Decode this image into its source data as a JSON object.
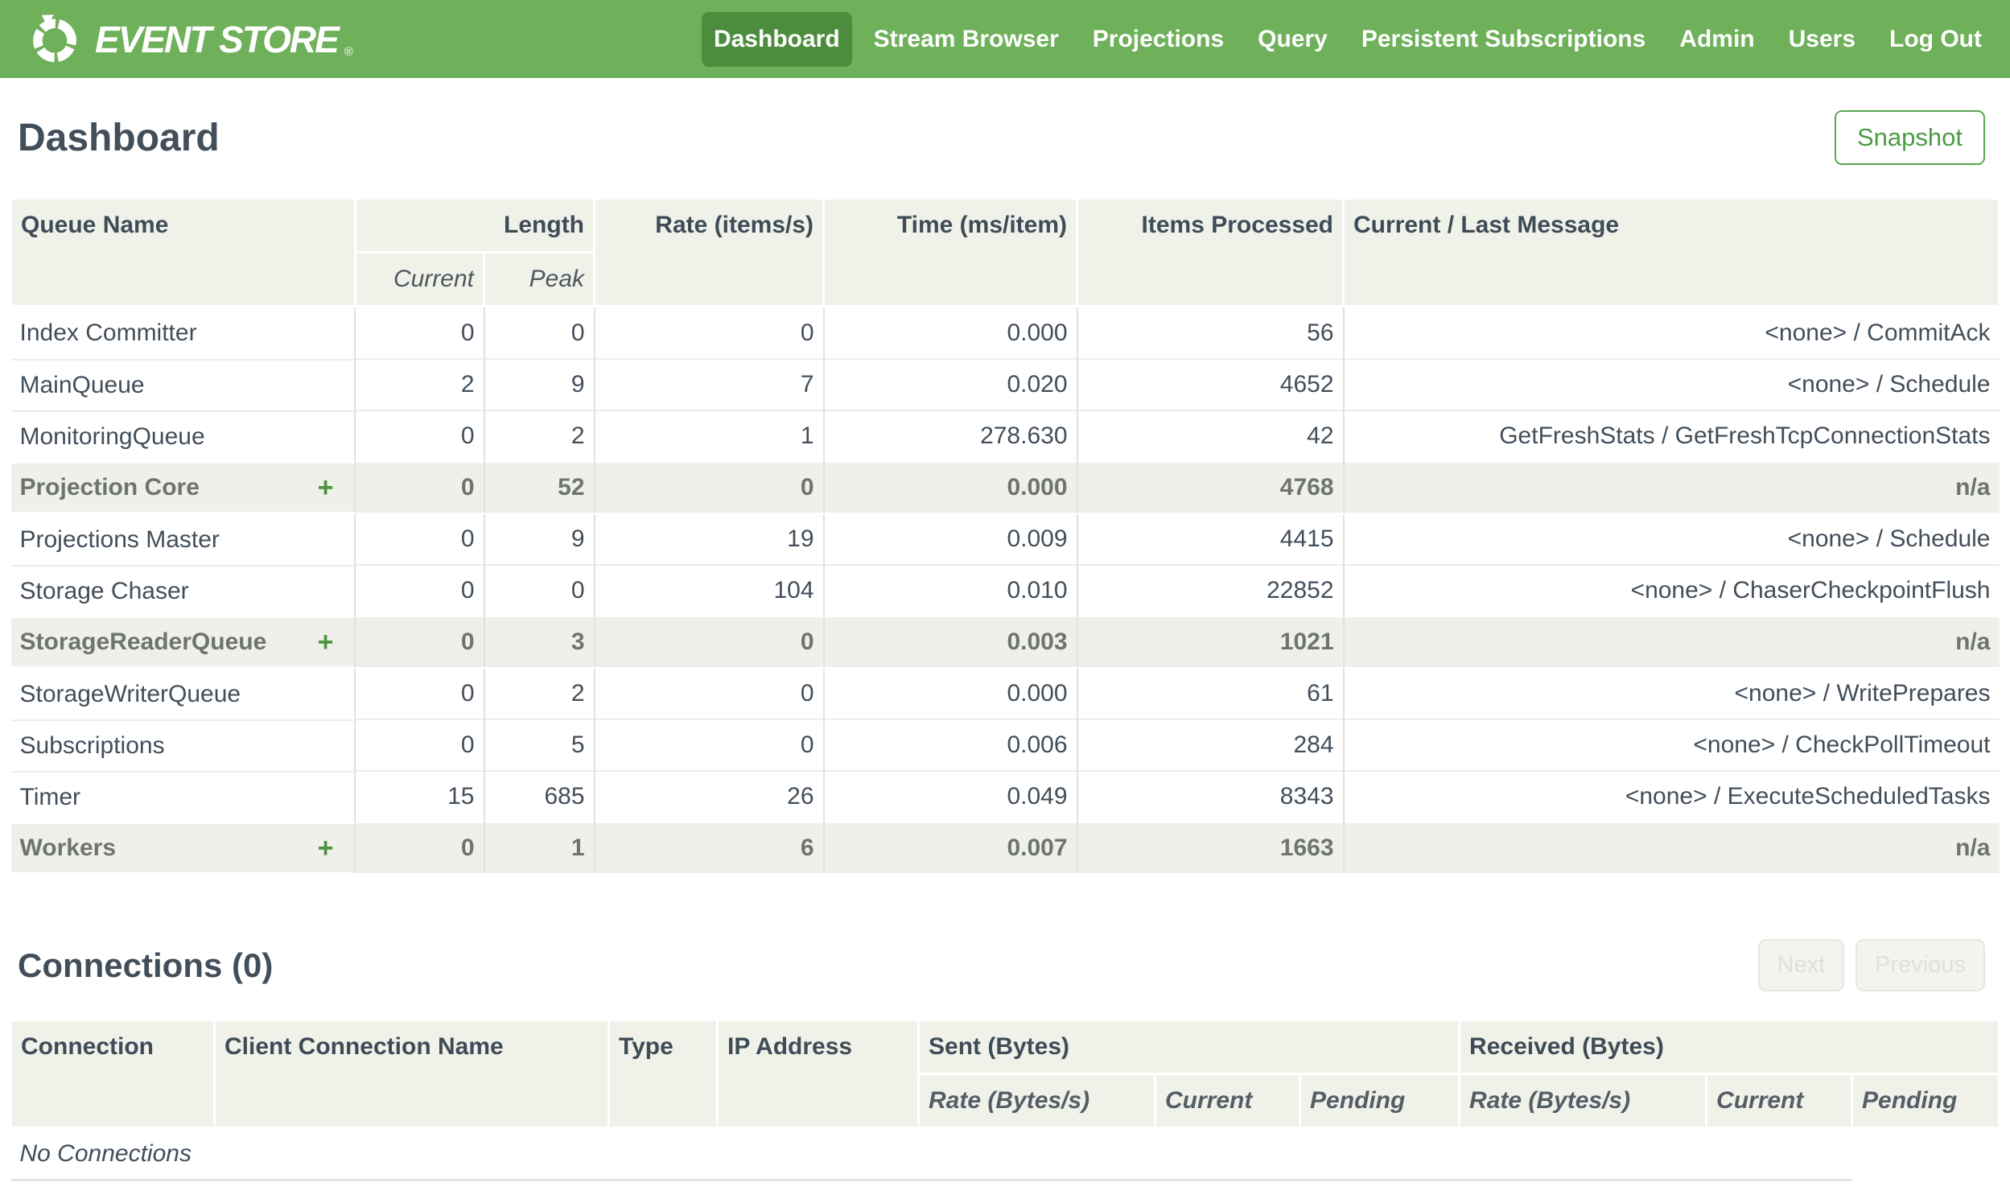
{
  "colors": {
    "brand_green": "#6FB05A",
    "active_nav_green": "#4C8D3D",
    "accent_green": "#4C9B43",
    "header_bg": "#F0F2EA",
    "summary_row_bg": "#EEF0E9",
    "text_dark": "#424E5A"
  },
  "nav": {
    "brand": "EVENT STORE",
    "brand_reg": "®",
    "items": [
      {
        "label": "Dashboard",
        "active": true
      },
      {
        "label": "Stream Browser",
        "active": false
      },
      {
        "label": "Projections",
        "active": false
      },
      {
        "label": "Query",
        "active": false
      },
      {
        "label": "Persistent Subscriptions",
        "active": false
      },
      {
        "label": "Admin",
        "active": false
      },
      {
        "label": "Users",
        "active": false
      },
      {
        "label": "Log Out",
        "active": false
      }
    ]
  },
  "page": {
    "title": "Dashboard",
    "snapshot_button": "Snapshot"
  },
  "queue_table": {
    "expand_icon": "+",
    "headers": {
      "queue_name": "Queue Name",
      "length": "Length",
      "current": "Current",
      "peak": "Peak",
      "rate": "Rate (items/s)",
      "time": "Time (ms/item)",
      "items_processed": "Items Processed",
      "message": "Current / Last Message"
    },
    "rows": [
      {
        "name": "Index Committer",
        "current": "0",
        "peak": "0",
        "rate": "0",
        "time": "0.000",
        "items": "56",
        "message": "<none> / CommitAck",
        "summary": false,
        "expandable": false
      },
      {
        "name": "MainQueue",
        "current": "2",
        "peak": "9",
        "rate": "7",
        "time": "0.020",
        "items": "4652",
        "message": "<none> / Schedule",
        "summary": false,
        "expandable": false
      },
      {
        "name": "MonitoringQueue",
        "current": "0",
        "peak": "2",
        "rate": "1",
        "time": "278.630",
        "items": "42",
        "message": "GetFreshStats / GetFreshTcpConnectionStats",
        "summary": false,
        "expandable": false
      },
      {
        "name": "Projection Core",
        "current": "0",
        "peak": "52",
        "rate": "0",
        "time": "0.000",
        "items": "4768",
        "message": "n/a",
        "summary": true,
        "expandable": true
      },
      {
        "name": "Projections Master",
        "current": "0",
        "peak": "9",
        "rate": "19",
        "time": "0.009",
        "items": "4415",
        "message": "<none> / Schedule",
        "summary": false,
        "expandable": false
      },
      {
        "name": "Storage Chaser",
        "current": "0",
        "peak": "0",
        "rate": "104",
        "time": "0.010",
        "items": "22852",
        "message": "<none> / ChaserCheckpointFlush",
        "summary": false,
        "expandable": false
      },
      {
        "name": "StorageReaderQueue",
        "current": "0",
        "peak": "3",
        "rate": "0",
        "time": "0.003",
        "items": "1021",
        "message": "n/a",
        "summary": true,
        "expandable": true
      },
      {
        "name": "StorageWriterQueue",
        "current": "0",
        "peak": "2",
        "rate": "0",
        "time": "0.000",
        "items": "61",
        "message": "<none> / WritePrepares",
        "summary": false,
        "expandable": false
      },
      {
        "name": "Subscriptions",
        "current": "0",
        "peak": "5",
        "rate": "0",
        "time": "0.006",
        "items": "284",
        "message": "<none> / CheckPollTimeout",
        "summary": false,
        "expandable": false
      },
      {
        "name": "Timer",
        "current": "15",
        "peak": "685",
        "rate": "26",
        "time": "0.049",
        "items": "8343",
        "message": "<none> / ExecuteScheduledTasks",
        "summary": false,
        "expandable": false
      },
      {
        "name": "Workers",
        "current": "0",
        "peak": "1",
        "rate": "6",
        "time": "0.007",
        "items": "1663",
        "message": "n/a",
        "summary": true,
        "expandable": true
      }
    ]
  },
  "connections": {
    "title": "Connections (0)",
    "next_button": "Next",
    "previous_button": "Previous",
    "headers": {
      "connection": "Connection",
      "client_connection_name": "Client Connection Name",
      "type": "Type",
      "ip_address": "IP Address",
      "sent": "Sent (Bytes)",
      "received": "Received (Bytes)",
      "rate": "Rate (Bytes/s)",
      "current": "Current",
      "pending": "Pending"
    },
    "empty_message": "No Connections"
  }
}
